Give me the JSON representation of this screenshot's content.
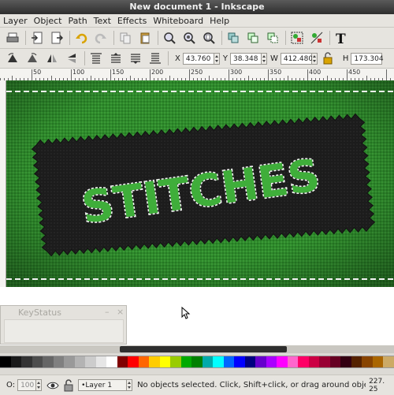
{
  "window": {
    "title": "New document 1 - Inkscape"
  },
  "menu": [
    "Layer",
    "Object",
    "Path",
    "Text",
    "Effects",
    "Whiteboard",
    "Help"
  ],
  "toolbar1": [
    "print-icon",
    "import-icon",
    "export-icon",
    "undo-icon",
    "redo-icon",
    "copy-icon",
    "paste-icon",
    "zoom-selection-icon",
    "zoom-drawing-icon",
    "zoom-page-icon",
    "duplicate-icon",
    "clone-icon",
    "unlink-clone-icon",
    "group-icon",
    "ungroup-icon",
    "text-icon"
  ],
  "toolbar2": {
    "x_label": "X",
    "x_value": "43.760",
    "y_label": "Y",
    "y_value": "38.348",
    "w_label": "W",
    "w_value": "412.480",
    "h_label": "H",
    "h_value": "173.304"
  },
  "ruler": {
    "labels": [
      "50",
      "100",
      "150",
      "200",
      "250",
      "300",
      "350",
      "400",
      "450"
    ]
  },
  "canvas": {
    "artwork_text": "STITCHES"
  },
  "keystatus": {
    "title": "KeyStatus",
    "minimize": "–",
    "close": "×"
  },
  "palette": {
    "colors": [
      "#000000",
      "#1a1a1a",
      "#333333",
      "#4d4d4d",
      "#666666",
      "#808080",
      "#999999",
      "#b3b3b3",
      "#cccccc",
      "#e6e6e6",
      "#ffffff",
      "#800000",
      "#ff0000",
      "#ff6600",
      "#ffcc00",
      "#ffff00",
      "#99cc00",
      "#00aa00",
      "#008000",
      "#00aaaa",
      "#00ffff",
      "#0066ff",
      "#0000ff",
      "#000080",
      "#6600cc",
      "#aa00ff",
      "#ff00ff",
      "#ff66cc",
      "#ff0066",
      "#cc0044",
      "#990033",
      "#660022",
      "#330011",
      "#552200",
      "#884400",
      "#aa6600",
      "#ccaa66"
    ]
  },
  "statusbar": {
    "o_label": "O:",
    "o_value": "100",
    "layer": "•Layer 1",
    "message": "No objects selected. Click, Shift+click, or drag around objects to",
    "coord_x": "227.",
    "coord_y": "25"
  }
}
